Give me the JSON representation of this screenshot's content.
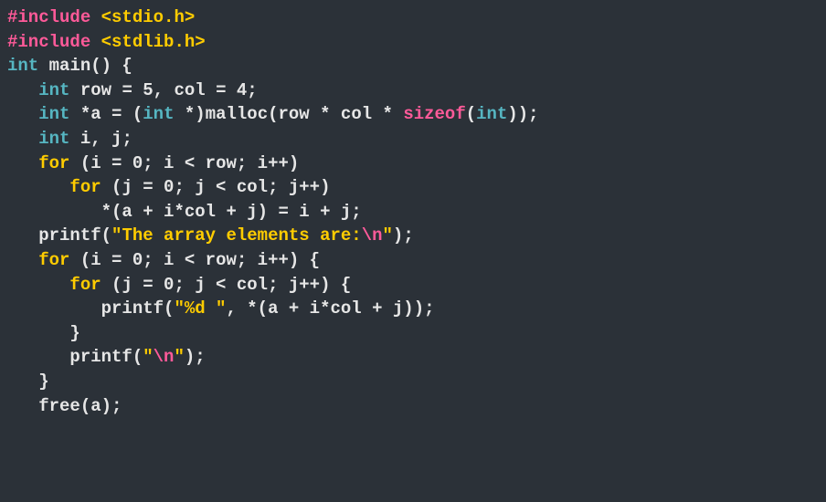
{
  "code": {
    "line1": {
      "preproc": "#include ",
      "header": "<stdio.h>"
    },
    "line2": {
      "preproc": "#include ",
      "header": "<stdlib.h>"
    },
    "line3": {
      "type1": "int",
      "rest": " main() {"
    },
    "line4": {
      "indent": "   ",
      "type1": "int",
      "rest": " row = 5, col = 4;"
    },
    "line5": {
      "indent": "   ",
      "type1": "int",
      "mid1": " *a = (",
      "type2": "int",
      "mid2": " *)malloc(row * col * ",
      "sizeof": "sizeof",
      "mid3": "(",
      "type3": "int",
      "rest": "));"
    },
    "line6": {
      "indent": "   ",
      "type1": "int",
      "rest": " i, j;"
    },
    "line7": {
      "indent": "   ",
      "kw": "for",
      "rest": " (i = 0; i < row; i++)"
    },
    "line8": {
      "indent": "      ",
      "kw": "for",
      "rest": " (j = 0; j < col; j++)"
    },
    "line9": {
      "indent": "         ",
      "rest": "*(a + i*col + j) = i + j;"
    },
    "line10": {
      "indent": "   ",
      "func": "printf(",
      "str1": "\"The array elements are:",
      "esc": "\\n",
      "str2": "\"",
      "rest": ");"
    },
    "line11": {
      "indent": "   ",
      "kw": "for",
      "rest": " (i = 0; i < row; i++) {"
    },
    "line12": {
      "indent": "      ",
      "kw": "for",
      "rest": " (j = 0; j < col; j++) {"
    },
    "line13": {
      "indent": "         ",
      "func": "printf(",
      "str": "\"%d \"",
      "rest": ", *(a + i*col + j));"
    },
    "line14": {
      "indent": "      ",
      "rest": "}"
    },
    "line15": {
      "indent": "      ",
      "func": "printf(",
      "str1": "\"",
      "esc": "\\n",
      "str2": "\"",
      "rest": ");"
    },
    "line16": {
      "indent": "   ",
      "rest": "}"
    },
    "line17": {
      "indent": "   ",
      "rest": "free(a);"
    }
  }
}
